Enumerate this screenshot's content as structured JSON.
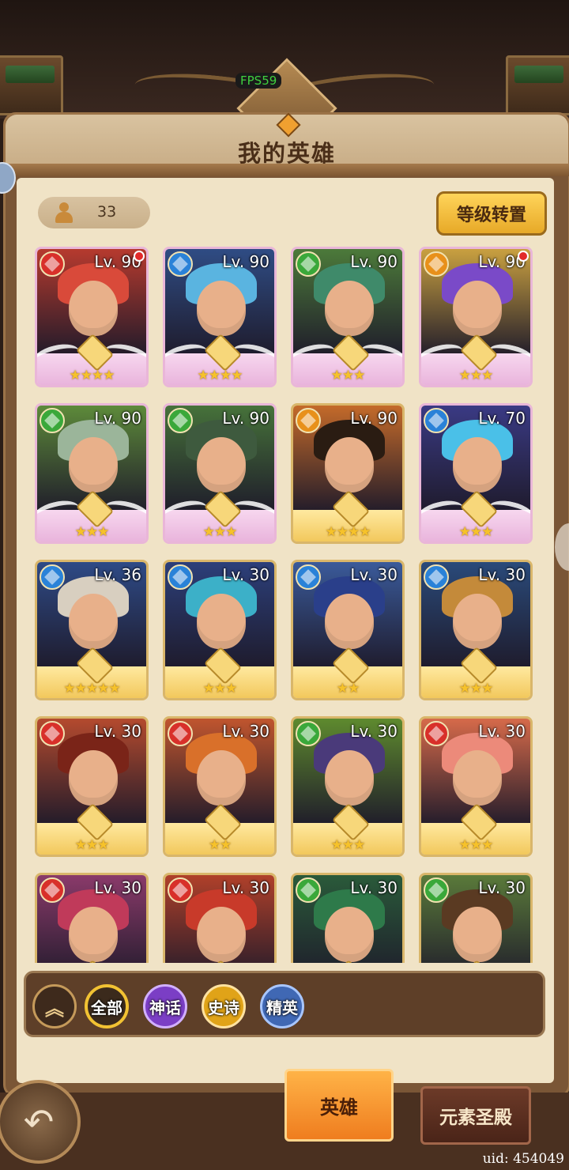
{
  "hud": {
    "fps": "FPS59"
  },
  "header": {
    "title": "我的英雄"
  },
  "hero_count": "33",
  "buttons": {
    "level_reset": "等级转置"
  },
  "heroes": [
    {
      "level": "Lv. 90",
      "element": "fire",
      "stars": "★★★★",
      "tier": "mythic",
      "badge": true,
      "hair": "#d94a3a",
      "bg": "#b63a2e"
    },
    {
      "level": "Lv. 90",
      "element": "water",
      "stars": "★★★★",
      "tier": "mythic",
      "badge": false,
      "hair": "#5ab4e0",
      "bg": "#2f4c84"
    },
    {
      "level": "Lv. 90",
      "element": "wind",
      "stars": "★★★",
      "tier": "mythic",
      "badge": false,
      "hair": "#3f8a6a",
      "bg": "#4c7a3a"
    },
    {
      "level": "Lv. 90",
      "element": "earth",
      "stars": "★★★",
      "tier": "mythic",
      "badge": true,
      "hair": "#7a4ac8",
      "bg": "#c9a040"
    },
    {
      "level": "Lv. 90",
      "element": "wind",
      "stars": "★★★",
      "tier": "mythic",
      "badge": false,
      "hair": "#9bb59a",
      "bg": "#5d8a3a"
    },
    {
      "level": "Lv. 90",
      "element": "wind",
      "stars": "★★★",
      "tier": "mythic",
      "badge": false,
      "hair": "#3e5a3e",
      "bg": "#46723a"
    },
    {
      "level": "Lv. 90",
      "element": "earth",
      "stars": "★★★★",
      "tier": "epic",
      "badge": false,
      "hair": "#2a1c12",
      "bg": "#c46a2a"
    },
    {
      "level": "Lv. 70",
      "element": "water",
      "stars": "★★★",
      "tier": "mythic",
      "badge": false,
      "hair": "#4ac0e8",
      "bg": "#3a3a84"
    },
    {
      "level": "Lv. 36",
      "element": "water",
      "stars": "★★★★★",
      "tier": "epic",
      "badge": false,
      "hair": "#d8cfc0",
      "bg": "#2e4a86"
    },
    {
      "level": "Lv. 30",
      "element": "water",
      "stars": "★★★",
      "tier": "epic",
      "badge": false,
      "hair": "#3cb0c8",
      "bg": "#2c3f7a"
    },
    {
      "level": "Lv. 30",
      "element": "water",
      "stars": "★★",
      "tier": "epic",
      "badge": false,
      "hair": "#2a3f8a",
      "bg": "#3a5a9a"
    },
    {
      "level": "Lv. 30",
      "element": "water",
      "stars": "★★★",
      "tier": "epic",
      "badge": false,
      "hair": "#c48a3a",
      "bg": "#2a4a7a"
    },
    {
      "level": "Lv. 30",
      "element": "fire",
      "stars": "★★★",
      "tier": "epic",
      "badge": false,
      "hair": "#7a2418",
      "bg": "#b44a2e"
    },
    {
      "level": "Lv. 30",
      "element": "fire",
      "stars": "★★",
      "tier": "epic",
      "badge": false,
      "hair": "#d9702a",
      "bg": "#c0552e"
    },
    {
      "level": "Lv. 30",
      "element": "wind",
      "stars": "★★★",
      "tier": "epic",
      "badge": false,
      "hair": "#4a3a7a",
      "bg": "#5e8a2e"
    },
    {
      "level": "Lv. 30",
      "element": "fire",
      "stars": "★★★",
      "tier": "epic",
      "badge": false,
      "hair": "#ec8a7a",
      "bg": "#d66a4a"
    },
    {
      "level": "Lv. 30",
      "element": "fire",
      "stars": "",
      "tier": "epic",
      "badge": false,
      "hair": "#c03a5a",
      "bg": "#8a3a6a"
    },
    {
      "level": "Lv. 30",
      "element": "fire",
      "stars": "",
      "tier": "epic",
      "badge": false,
      "hair": "#c83a2a",
      "bg": "#b0402a"
    },
    {
      "level": "Lv. 30",
      "element": "wind",
      "stars": "",
      "tier": "epic",
      "badge": false,
      "hair": "#2e7a4a",
      "bg": "#2a5a3a"
    },
    {
      "level": "Lv. 30",
      "element": "wind",
      "stars": "",
      "tier": "epic",
      "badge": false,
      "hair": "#5a3a22",
      "bg": "#5a7a3a"
    }
  ],
  "element_colors": {
    "fire": "#d8302a",
    "water": "#2a82d8",
    "wind": "#3aa83a",
    "earth": "#e8901a"
  },
  "filters": {
    "all": "全部",
    "mythic": "神话",
    "epic": "史诗",
    "elite": "精英"
  },
  "tabs": {
    "heroes": "英雄",
    "element_temple": "元素圣殿"
  },
  "footer": {
    "uid": "uid: 454049"
  }
}
